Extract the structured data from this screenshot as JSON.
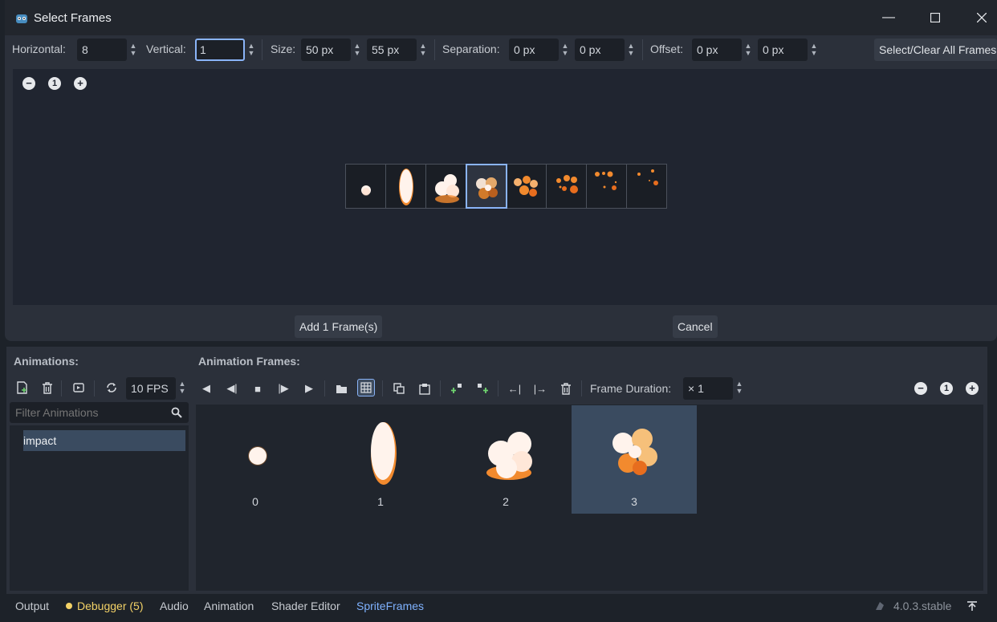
{
  "dialog": {
    "title": "Select Frames",
    "toolbar": {
      "horizontal_label": "Horizontal:",
      "horizontal_value": "8",
      "vertical_label": "Vertical:",
      "vertical_value": "1",
      "size_label": "Size:",
      "size_x": "50 px",
      "size_y": "55 px",
      "separation_label": "Separation:",
      "separation_x": "0 px",
      "separation_y": "0 px",
      "offset_label": "Offset:",
      "offset_x": "0 px",
      "offset_y": "0 px",
      "select_clear_label": "Select/Clear All Frames"
    },
    "zoom_reset_label": "1",
    "frame_count": 8,
    "selected_frame_index": 3,
    "add_button": "Add 1 Frame(s)",
    "cancel_button": "Cancel"
  },
  "panel": {
    "animations_header": "Animations:",
    "frames_header": "Animation Frames:",
    "fps_value": "10 FPS",
    "frame_duration_label": "Frame Duration:",
    "frame_duration_value": "× 1",
    "zoom_reset_label": "1",
    "filter_placeholder": "Filter Animations",
    "animations": [
      "impact"
    ],
    "frames": [
      {
        "label": "0",
        "selected": false
      },
      {
        "label": "1",
        "selected": false
      },
      {
        "label": "2",
        "selected": false
      },
      {
        "label": "3",
        "selected": true
      }
    ]
  },
  "bottom_tabs": {
    "output": "Output",
    "debugger": "Debugger (5)",
    "audio": "Audio",
    "animation": "Animation",
    "shader_editor": "Shader Editor",
    "spriteframes": "SpriteFrames",
    "version": "4.0.3.stable"
  },
  "colors": {
    "accent": "#8ab4f8",
    "debugger": "#f3d267",
    "active_tab": "#7fb2ff",
    "sprite_light": "#fff3ec",
    "sprite_orange": "#f28a2e"
  }
}
